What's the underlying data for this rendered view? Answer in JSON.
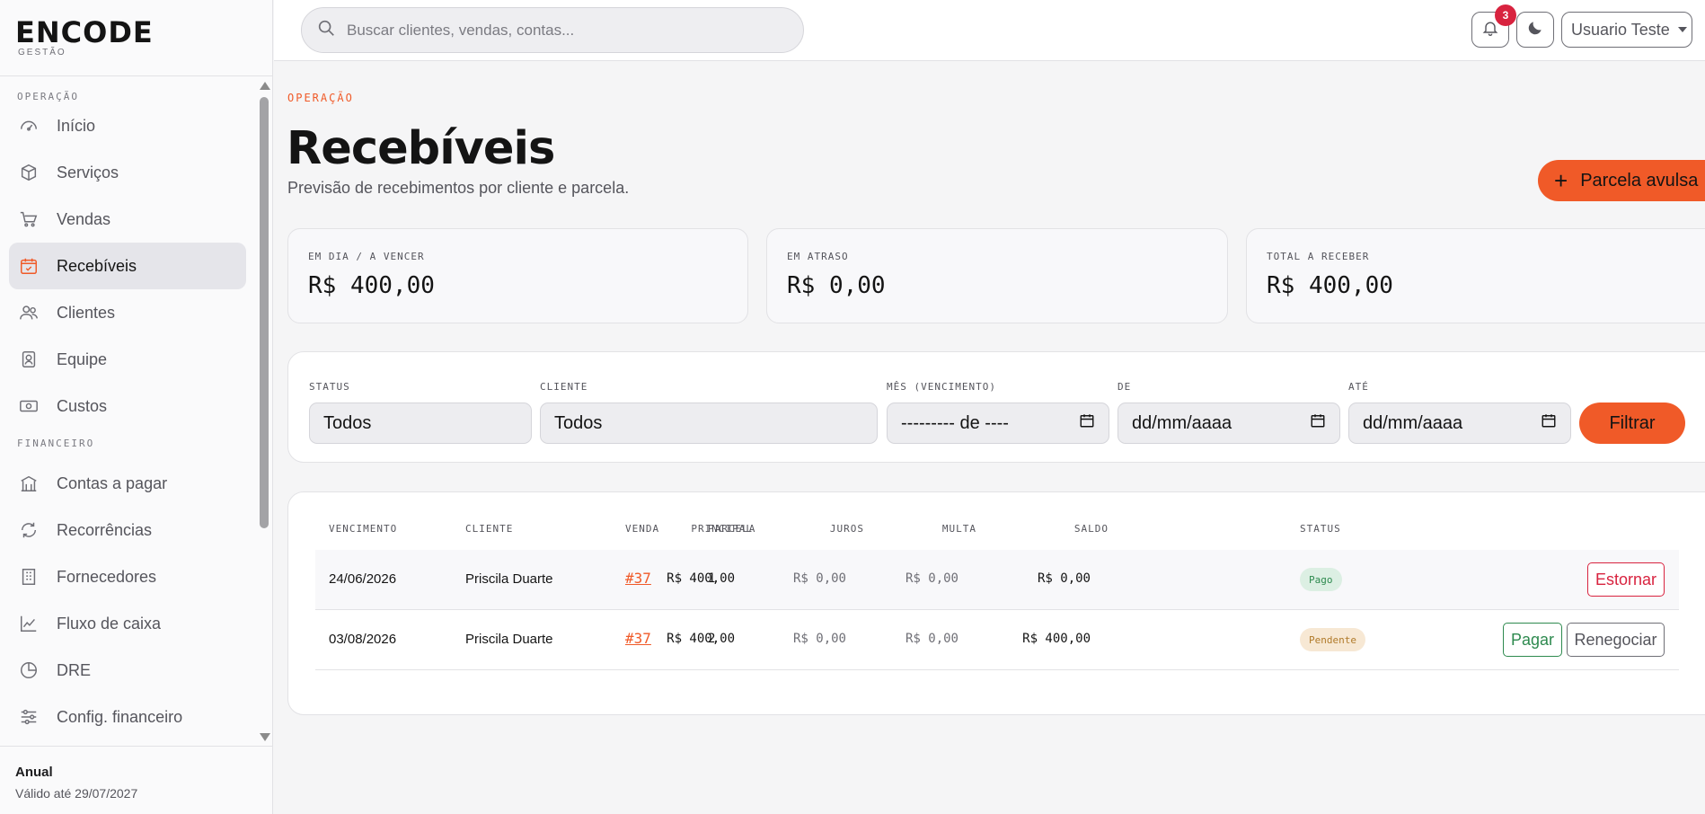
{
  "brand": {
    "logo": "ENCODE",
    "sub": "GESTÃO"
  },
  "sidebar": {
    "sections": [
      {
        "title": "OPERAÇÃO"
      },
      {
        "title": "FINANCEIRO"
      }
    ],
    "items": [
      {
        "label": "Início",
        "icon": "gauge-icon"
      },
      {
        "label": "Serviços",
        "icon": "box-icon"
      },
      {
        "label": "Vendas",
        "icon": "cart-icon"
      },
      {
        "label": "Recebíveis",
        "icon": "calendar-check-icon",
        "active": true
      },
      {
        "label": "Clientes",
        "icon": "users-icon"
      },
      {
        "label": "Equipe",
        "icon": "badge-icon"
      },
      {
        "label": "Custos",
        "icon": "cash-icon"
      },
      {
        "label": "Contas a pagar",
        "icon": "building-icon"
      },
      {
        "label": "Recorrências",
        "icon": "refresh-icon"
      },
      {
        "label": "Fornecedores",
        "icon": "office-icon"
      },
      {
        "label": "Fluxo de caixa",
        "icon": "line-chart-icon"
      },
      {
        "label": "DRE",
        "icon": "pie-chart-icon"
      },
      {
        "label": "Config. financeiro",
        "icon": "sliders-icon"
      }
    ]
  },
  "plan": {
    "name": "Anual",
    "valid": "Válido até 29/07/2027"
  },
  "topbar": {
    "search_placeholder": "Buscar clientes, vendas, contas...",
    "notifications_count": "3",
    "user_name": "Usuario Teste"
  },
  "page": {
    "eyebrow": "OPERAÇÃO",
    "title": "Recebíveis",
    "subtitle": "Previsão de recebimentos por cliente e parcela.",
    "cta_label": "Parcela avulsa"
  },
  "stats": [
    {
      "label": "EM DIA / A VENCER",
      "value": "R$ 400,00"
    },
    {
      "label": "EM ATRASO",
      "value": "R$ 0,00"
    },
    {
      "label": "TOTAL A RECEBER",
      "value": "R$ 400,00"
    }
  ],
  "filters": {
    "status_label": "STATUS",
    "status_value": "Todos",
    "cliente_label": "CLIENTE",
    "cliente_value": "Todos",
    "mes_label": "MÊS (VENCIMENTO)",
    "mes_value": "--------- de ----",
    "de_label": "DE",
    "de_value": "dd/mm/aaaa",
    "ate_label": "ATÉ",
    "ate_value": "dd/mm/aaaa",
    "button": "Filtrar"
  },
  "table": {
    "headers": [
      "VENCIMENTO",
      "CLIENTE",
      "VENDA",
      "PARCELA",
      "PRINCIPAL",
      "JUROS",
      "MULTA",
      "SALDO",
      "STATUS"
    ],
    "rows": [
      {
        "vencimento": "24/06/2026",
        "cliente": "Priscila Duarte",
        "venda": "#37",
        "parcela": "1",
        "principal": "R$ 400,00",
        "juros": "R$ 0,00",
        "multa": "R$ 0,00",
        "saldo": "R$ 0,00",
        "status": "Pago",
        "actions": [
          "Estornar"
        ]
      },
      {
        "vencimento": "03/08/2026",
        "cliente": "Priscila Duarte",
        "venda": "#37",
        "parcela": "2",
        "principal": "R$ 400,00",
        "juros": "R$ 0,00",
        "multa": "R$ 0,00",
        "saldo": "R$ 400,00",
        "status": "Pendente",
        "actions": [
          "Pagar",
          "Renegociar"
        ]
      }
    ]
  },
  "colors": {
    "accent": "#f05a28",
    "danger": "#d8233f",
    "success": "#2e8a4f",
    "warning": "#b07a2a"
  }
}
